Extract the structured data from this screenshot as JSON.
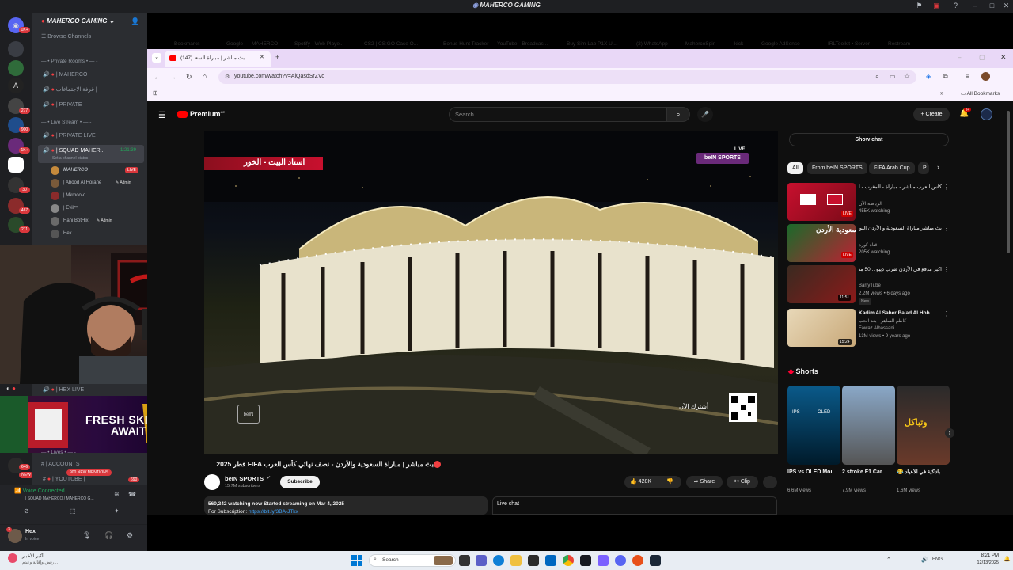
{
  "discord": {
    "window_title": "MAHERCO GAMING",
    "server_name": "MAHERCO GAMING",
    "browse_channels": "Browse Channels",
    "server_badges": [
      "1K+",
      "4",
      "277",
      "900",
      "1K+",
      "30",
      "467",
      "211",
      "646",
      "NEW"
    ],
    "rail_letter": "A",
    "categories": [
      {
        "label": "— • Private Rooms • — -"
      },
      {
        "label": "— • Live Stream • — -"
      },
      {
        "label": "— • Lives • — -"
      }
    ],
    "channels": [
      {
        "label": "| MAHERCO"
      },
      {
        "label": "غرفة الاجتماعات |"
      },
      {
        "label": "| PRIVATE"
      },
      {
        "label": "| PRIVATE LIVE"
      },
      {
        "label": "| SQUAD MAHER..."
      },
      {
        "label": "| HEX LIVE"
      },
      {
        "label": "| ACCOUNTS"
      },
      {
        "label": "| YOUTUBE |"
      }
    ],
    "squad_timer": "1:21:39",
    "channel_status": "Set a channel status",
    "voice_users": [
      {
        "name": "MAHERCO",
        "badge": "LIVE"
      },
      {
        "name": "| Abood Al Horane",
        "badge": "Admin"
      },
      {
        "name": "| Mkmoo-o",
        "badge": ""
      },
      {
        "name": "| Evil™",
        "badge": ""
      },
      {
        "name": "Hani BotHix",
        "badge": "Admin"
      },
      {
        "name": "Hex",
        "badge": ""
      }
    ],
    "mentions_badge": "900 NEW MENTIONS",
    "youtube_count": "690",
    "voice_connected": "Voice Connected",
    "voice_channel": "| SQUAD MAHERCO / MAHERCO G...",
    "user_name": "Hex",
    "user_status": "In voice",
    "user_badge": "3"
  },
  "promo": {
    "line1": "FRESH SKINS",
    "line2": "AWAIT"
  },
  "browser": {
    "tab_title": "(147) بث مباشر | مباراة السعـ...",
    "url": "youtube.com/watch?v=AiQasdSrZVo",
    "bookmarks": [
      "Bookmarks",
      "Google",
      "MAHERCO",
      "Spotify - Web Playe...",
      "CS2 | CS:GO Case O...",
      "Bonus Hunt Tracker",
      "YouTube - Broadcas...",
      "Buy Sim-Lab P1X Ul...",
      "(2) WhatsApp",
      "MahercoSpin",
      "kick",
      "Google AdSense",
      "IRLToolkit • Server",
      "Restream"
    ],
    "all_bookmarks": "All Bookmarks"
  },
  "youtube": {
    "logo": "Premium",
    "logo_sup": "AE",
    "search_placeholder": "Search",
    "create": "Create",
    "notif_count": "9+",
    "video_banner": "استاد البيت - الخور",
    "channel_watermark": "beIN SPORTS",
    "live_tag": "LIVE",
    "qr_caption": "أشترك الآن",
    "video_title": "بث مباشر | مباراة السعودية والأردن - نصف نهائي كأس العرب FIFA قطر 2025",
    "channel": "beIN SPORTS",
    "subscribers": "15.7M subscribers",
    "subscribe": "Subscribe",
    "likes": "428K",
    "share": "Share",
    "clip": "Clip",
    "watching": "560,242 watching now  Started streaming on Mar 4, 2025",
    "for_subscription": "For Subscription:",
    "sub_link": "https://bit.ly/3BA-JTkx",
    "live_chat": "Live chat",
    "show_chat": "Show chat",
    "chips": [
      "All",
      "From beIN SPORTS",
      "FIFA Arab Cup",
      "P"
    ],
    "recs": [
      {
        "title": "كأس العرب مباشر - مباراة - المغرب - الإمارات",
        "channel": "الرياضة الآن",
        "meta": "455K watching",
        "badge": "LIVE"
      },
      {
        "title": "بث مباشر مباراة السعودية و الأردن اليوم | نصف نهائي كأس العرب 2025 | تاريخ",
        "channel": "قناة كورة",
        "meta": "205K watching",
        "badge": "LIVE"
      },
      {
        "title": "اكبر مدفع في الأردن ضرب ديبو .. 50 مصاب",
        "channel": "BarryTube",
        "meta": "2.2M views • 6 days ago",
        "badge": "11:51",
        "extra": "New"
      },
      {
        "title": "Kadim Al Saher Ba'ad Al Hob",
        "channel": "Fawaz Alhassani",
        "meta": "13M views • 9 years ago",
        "badge": "15:24",
        "sub": "كاظم الساهر - بعد الحب"
      }
    ],
    "thumb_text": "السعودية الأردن",
    "shorts_title": "Shorts",
    "shorts": [
      {
        "title": "IPS vs OLED Monitor 😮",
        "views": "6.6M views",
        "tag1": "IPS",
        "tag2": "OLED"
      },
      {
        "title": "2 stroke F1 Car 😱",
        "views": "7.9M views"
      },
      {
        "title": "باتاكية في الأعياد 😂 الجزائر جديد",
        "views": "1.6M views",
        "overlay": "وتباكل"
      }
    ]
  },
  "taskbar": {
    "weather_line1": "أكبر الأخبار",
    "weather_line2": "رفض وإقالة وعدم...",
    "search": "Search",
    "lang": "ENG",
    "time": "8:21 PM",
    "date": "12/13/2025"
  }
}
